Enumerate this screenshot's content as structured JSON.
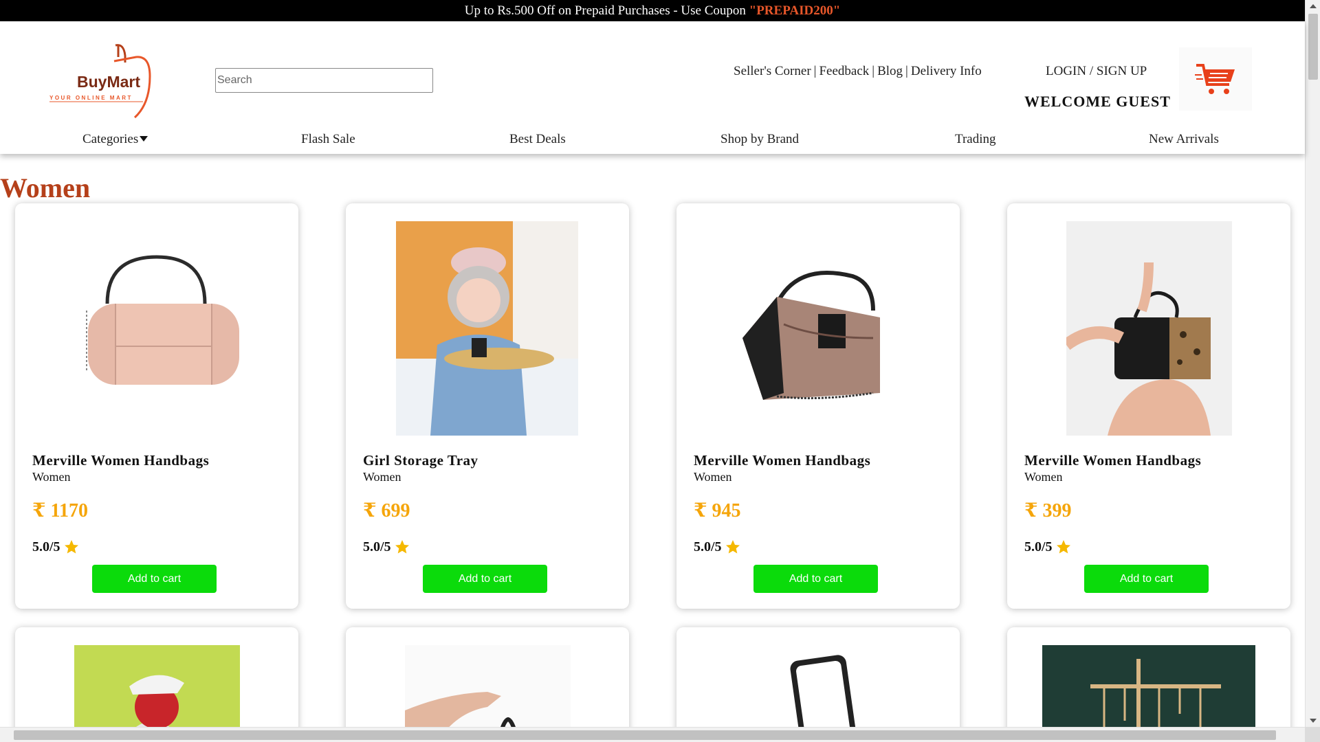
{
  "promo": {
    "text": "Up to Rs.500 Off on Prepaid Purchases - Use Coupon ",
    "coupon": "\"PREPAID200\""
  },
  "brand": {
    "name": "BuyMart",
    "tagline": "YOUR ONLINE MART",
    "accent": "#b5401a"
  },
  "search": {
    "placeholder": "Search",
    "value": ""
  },
  "top_links": [
    "Seller's Corner",
    "Feedback",
    "Blog",
    "Delivery Info"
  ],
  "auth": {
    "label": "LOGIN / SIGN UP",
    "welcome": "WELCOME GUEST"
  },
  "cart": {
    "icon": "cart-icon",
    "color": "#e8401a"
  },
  "nav": [
    "Categories",
    "Flash Sale",
    "Best Deals",
    "Shop by Brand",
    "Trading",
    "New Arrivals"
  ],
  "section": {
    "title": "Women"
  },
  "products": [
    {
      "name": "Merville Women Handbags",
      "category": "Women",
      "price": "₹ 1170",
      "rating": "5.0/5",
      "button": "Add to cart",
      "image": "pink-cylinder-handbag"
    },
    {
      "name": "Girl Storage Tray",
      "category": "Women",
      "price": "₹ 699",
      "rating": "5.0/5",
      "button": "Add to cart",
      "image": "girl-figurine-tray"
    },
    {
      "name": "Merville Women Handbags",
      "category": "Women",
      "price": "₹ 945",
      "rating": "5.0/5",
      "button": "Add to cart",
      "image": "snakeskin-handbag"
    },
    {
      "name": "Merville Women Handbags",
      "category": "Women",
      "price": "₹ 399",
      "rating": "5.0/5",
      "button": "Add to cart",
      "image": "leopard-handbag"
    }
  ],
  "products_row2_images": [
    "woman-cap-green",
    "hand-holding-bag",
    "led-mirror",
    "jewelry-stand"
  ],
  "colors": {
    "price": "#f5a50a",
    "button": "#0bdb0b",
    "star": "#f5b800"
  }
}
